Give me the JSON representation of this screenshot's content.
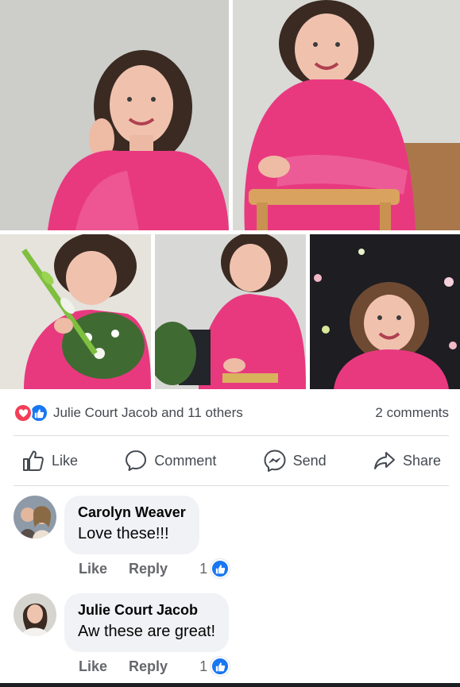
{
  "post": {
    "photos": [
      {
        "name": "photo-portrait-hand-in-hair"
      },
      {
        "name": "photo-portrait-on-chair"
      },
      {
        "name": "photo-holding-flowers"
      },
      {
        "name": "photo-at-laptop"
      },
      {
        "name": "photo-dark-backdrop"
      }
    ],
    "reactions": {
      "icons": [
        "love-reaction-icon",
        "like-reaction-icon"
      ],
      "summary": "Julie Court Jacob and 11 others",
      "comments_count": "2 comments"
    },
    "actions": [
      {
        "label": "Like",
        "icon": "thumbs-up-icon"
      },
      {
        "label": "Comment",
        "icon": "comment-bubble-icon"
      },
      {
        "label": "Send",
        "icon": "messenger-icon"
      },
      {
        "label": "Share",
        "icon": "share-arrow-icon"
      }
    ]
  },
  "comments": [
    {
      "author": "Carolyn Weaver",
      "text": "Love these!!!",
      "like_label": "Like",
      "reply_label": "Reply",
      "like_count": "1"
    },
    {
      "author": "Julie Court Jacob",
      "text": "Aw these are great!",
      "like_label": "Like",
      "reply_label": "Reply",
      "like_count": "1"
    }
  ],
  "colors": {
    "accent_blue": "#1877f2",
    "love_red": "#f33e58",
    "shirt_pink": "#e8397f",
    "bubble_bg": "#f0f2f5"
  }
}
